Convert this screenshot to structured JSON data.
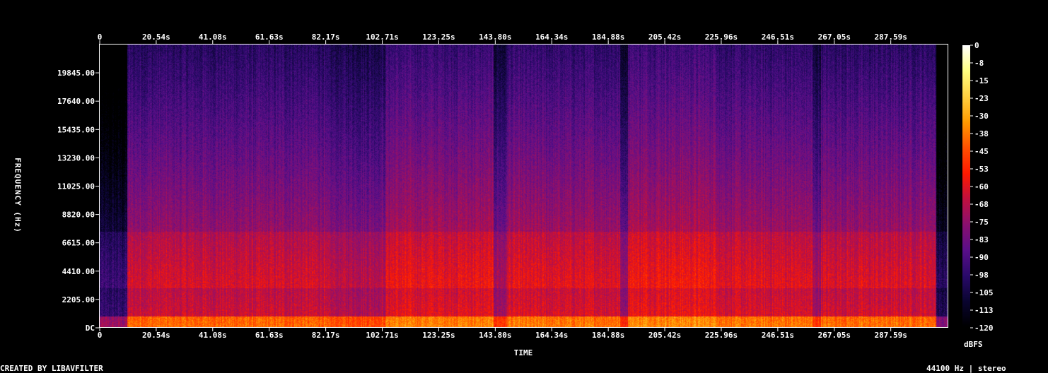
{
  "chart_data": {
    "type": "heatmap",
    "xlabel": "TIME",
    "ylabel": "FREQUENCY (Hz)",
    "x_ticks": [
      "0",
      "20.54s",
      "41.08s",
      "61.63s",
      "82.17s",
      "102.71s",
      "123.25s",
      "143.80s",
      "164.34s",
      "184.88s",
      "205.42s",
      "225.96s",
      "246.51s",
      "267.05s",
      "287.59s"
    ],
    "x_tick_values": [
      0,
      20.54,
      41.08,
      61.63,
      82.17,
      102.71,
      123.25,
      143.8,
      164.34,
      184.88,
      205.42,
      225.96,
      246.51,
      267.05,
      287.59
    ],
    "y_ticks": [
      "DC",
      "2205.00",
      "4410.00",
      "6615.00",
      "8820.00",
      "11025.00",
      "13230.00",
      "15435.00",
      "17640.00",
      "19845.00"
    ],
    "y_tick_values": [
      0,
      2205,
      4410,
      6615,
      8820,
      11025,
      13230,
      15435,
      17640,
      19845
    ],
    "xlim": [
      0,
      308.5
    ],
    "ylim": [
      0,
      22050
    ],
    "colorbar": {
      "label": "dBFS",
      "ticks": [
        "0",
        "-8",
        "-15",
        "-23",
        "-30",
        "-38",
        "-45",
        "-53",
        "-60",
        "-68",
        "-75",
        "-83",
        "-90",
        "-98",
        "-105",
        "-113",
        "-120"
      ],
      "range": [
        -120,
        0
      ]
    },
    "colormap": [
      "#000000",
      "#0a0530",
      "#2a0a6a",
      "#5a0f8a",
      "#8a1070",
      "#c01040",
      "#ff1a00",
      "#ff5000",
      "#ff9a00",
      "#ffd040",
      "#ffff80",
      "#ffffff"
    ],
    "segments": [
      {
        "start": 0,
        "end": 10,
        "level": -95
      },
      {
        "start": 10,
        "end": 82,
        "level": -62
      },
      {
        "start": 82,
        "end": 104,
        "level": -66
      },
      {
        "start": 104,
        "end": 143,
        "level": -58
      },
      {
        "start": 143,
        "end": 148,
        "level": -70
      },
      {
        "start": 148,
        "end": 189,
        "level": -60
      },
      {
        "start": 189,
        "end": 192,
        "level": -72
      },
      {
        "start": 192,
        "end": 225,
        "level": -56
      },
      {
        "start": 225,
        "end": 259,
        "level": -60
      },
      {
        "start": 259,
        "end": 262,
        "level": -70
      },
      {
        "start": 262,
        "end": 304,
        "level": -61
      },
      {
        "start": 304,
        "end": 308.5,
        "level": -100
      }
    ]
  },
  "footer": {
    "created_by": "CREATED BY LIBAVFILTER",
    "sample_info": "44100 Hz | stereo"
  }
}
